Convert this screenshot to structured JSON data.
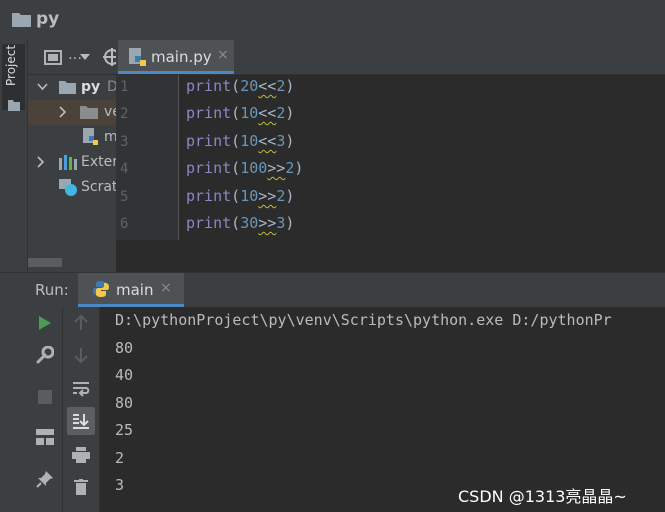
{
  "window": {
    "title": "py"
  },
  "left_stripe": {
    "project_tab": "Project"
  },
  "project_panel": {
    "toolbar_icon": "layout-icon",
    "toolbar_dots": "…",
    "tree": [
      {
        "label": "py",
        "suffix": "D",
        "expanded": true
      },
      {
        "label": "ve",
        "icon": "folder-icon"
      },
      {
        "label": "m",
        "icon": "python-file-icon"
      },
      {
        "label": "Exter",
        "icon": "libraries-icon"
      },
      {
        "label": "Scrat",
        "icon": "scratches-icon"
      }
    ]
  },
  "editor": {
    "tab": {
      "label": "main.py",
      "close": "×"
    },
    "lines": [
      {
        "n": "1",
        "fn": "print",
        "a": "20",
        "op": "<<",
        "b": "2"
      },
      {
        "n": "2",
        "fn": "print",
        "a": "10",
        "op": "<<",
        "b": "2"
      },
      {
        "n": "3",
        "fn": "print",
        "a": "10",
        "op": "<<",
        "b": "3"
      },
      {
        "n": "4",
        "fn": "print",
        "a": "100",
        "op": ">>",
        "b": "2"
      },
      {
        "n": "5",
        "fn": "print",
        "a": "10",
        "op": ">>",
        "b": "2"
      },
      {
        "n": "6",
        "fn": "print",
        "a": "30",
        "op": ">>",
        "b": "3"
      }
    ]
  },
  "run": {
    "label": "Run:",
    "tab": {
      "label": "main",
      "close": "×"
    },
    "console": [
      "D:\\pythonProject\\py\\venv\\Scripts\\python.exe D:/pythonPr",
      "80",
      "40",
      "80",
      "25",
      "2",
      "3"
    ]
  },
  "watermark": "CSDN @1313亮晶晶~",
  "colors": {
    "keyword": "#8888c6",
    "number": "#6897bb",
    "tab_underline": "#4a88c7",
    "run_green": "#499c54"
  }
}
